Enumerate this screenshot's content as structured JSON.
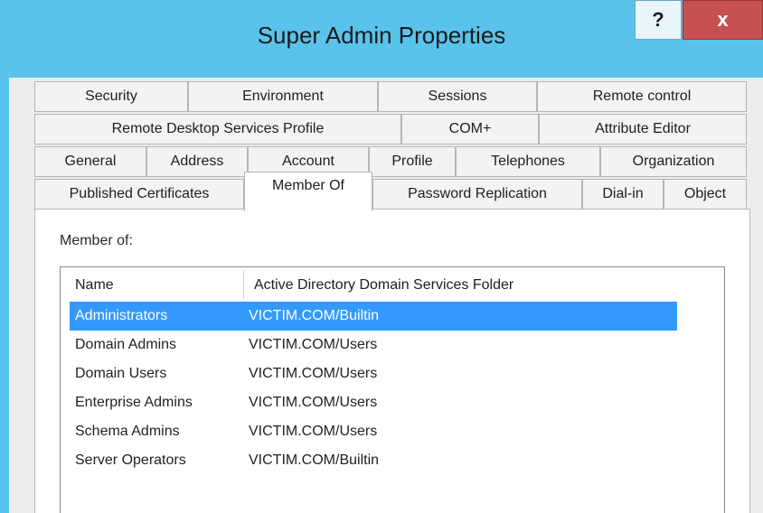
{
  "window": {
    "title": "Super Admin Properties",
    "help_label": "?",
    "close_label": "x"
  },
  "tabs": {
    "row1": [
      "Security",
      "Environment",
      "Sessions",
      "Remote control"
    ],
    "row2": [
      "Remote Desktop Services Profile",
      "COM+",
      "Attribute Editor"
    ],
    "row3": [
      "General",
      "Address",
      "Account",
      "Profile",
      "Telephones",
      "Organization"
    ],
    "row4": [
      "Published Certificates",
      "Member Of",
      "Password Replication",
      "Dial-in",
      "Object"
    ],
    "active": "Member Of"
  },
  "member_of": {
    "label": "Member of:",
    "columns": [
      "Name",
      "Active Directory Domain Services Folder"
    ],
    "rows": [
      {
        "name": "Administrators",
        "folder": "VICTIM.COM/Builtin",
        "selected": true
      },
      {
        "name": "Domain Admins",
        "folder": "VICTIM.COM/Users"
      },
      {
        "name": "Domain Users",
        "folder": "VICTIM.COM/Users"
      },
      {
        "name": "Enterprise Admins",
        "folder": "VICTIM.COM/Users"
      },
      {
        "name": "Schema Admins",
        "folder": "VICTIM.COM/Users"
      },
      {
        "name": "Server Operators",
        "folder": "VICTIM.COM/Builtin"
      }
    ]
  },
  "colors": {
    "title_bar": "#59c3ec",
    "close_button": "#c75050",
    "selection": "#3399ff"
  }
}
